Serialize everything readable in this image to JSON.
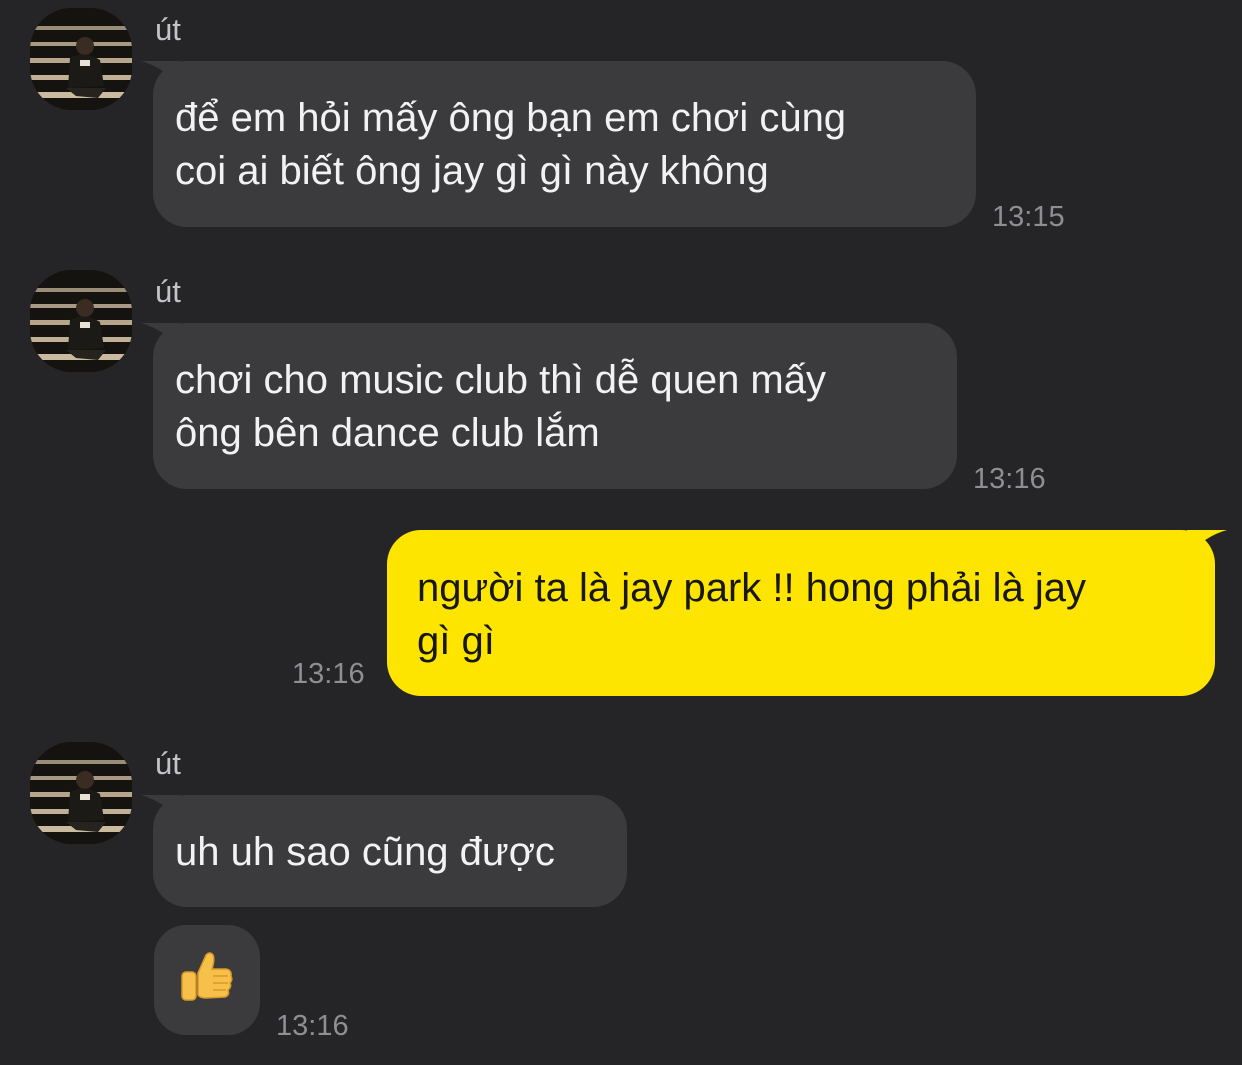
{
  "chat": {
    "messages": [
      {
        "sender": "út",
        "direction": "incoming",
        "text": "để em hỏi mấy ông bạn em chơi cùng\ncoi ai biết ông jay gì gì này không",
        "time": "13:15"
      },
      {
        "sender": "út",
        "direction": "incoming",
        "text": "chơi cho music club thì dễ quen mấy\nông bên dance club lắm",
        "time": "13:16"
      },
      {
        "direction": "outgoing",
        "text": "người ta là jay park !! hong phải là jay\ngì gì",
        "time": "13:16"
      },
      {
        "sender": "út",
        "direction": "incoming",
        "text": "uh uh sao cũng được"
      },
      {
        "direction": "incoming",
        "emoji": "thumbs-up-icon",
        "time": "13:16"
      }
    ]
  },
  "colors": {
    "background": "#252527",
    "incoming_bubble": "#3b3b3e",
    "outgoing_bubble": "#fde500",
    "timestamp": "#8e8e93",
    "sender_name": "#c4c4c8"
  }
}
